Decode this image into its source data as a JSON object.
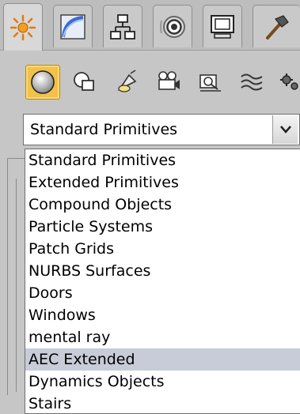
{
  "tabs": [
    {
      "icon": "create-sun-icon",
      "active": true
    },
    {
      "icon": "modify-curve-icon",
      "active": false
    },
    {
      "icon": "hierarchy-icon",
      "active": false
    },
    {
      "icon": "motion-icon",
      "active": false
    },
    {
      "icon": "display-monitor-icon",
      "active": false
    },
    {
      "icon": "utilities-hammer-icon",
      "active": false
    }
  ],
  "categories": [
    {
      "icon": "geometry-sphere-icon",
      "selected": true
    },
    {
      "icon": "shapes-icon",
      "selected": false
    },
    {
      "icon": "lights-icon",
      "selected": false
    },
    {
      "icon": "cameras-icon",
      "selected": false
    },
    {
      "icon": "helpers-icon",
      "selected": false
    },
    {
      "icon": "space-warps-icon",
      "selected": false
    },
    {
      "icon": "systems-icon",
      "selected": false
    }
  ],
  "dropdown": {
    "selected_value": "Standard Primitives",
    "options": [
      "Standard Primitives",
      "Extended Primitives",
      "Compound Objects",
      "Particle Systems",
      "Patch Grids",
      "NURBS Surfaces",
      "Doors",
      "Windows",
      "mental ray",
      "AEC Extended",
      "Dynamics Objects",
      "Stairs"
    ],
    "highlighted_option": "AEC Extended"
  },
  "colors": {
    "panel_bg": "#c6c6c6",
    "selected_category": "#f2c14a",
    "highlight_row": "#c8ccd8"
  }
}
